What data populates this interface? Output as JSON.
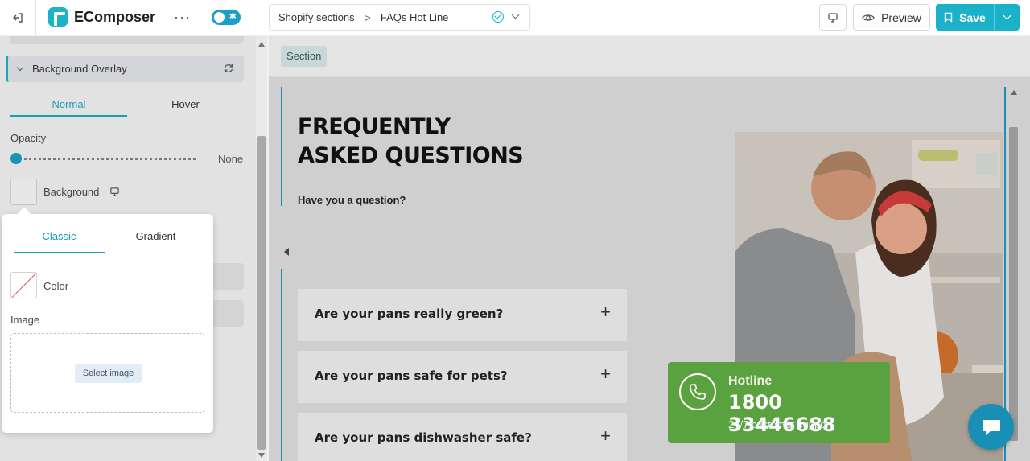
{
  "topbar": {
    "app_name": "EComposer",
    "more_label": "···",
    "breadcrumb": {
      "parent": "Shopify sections",
      "separator": ">",
      "current": "FAQs Hot Line"
    },
    "preview_label": "Preview",
    "save_label": "Save"
  },
  "left_panel": {
    "section_title": "Background Overlay",
    "tabs": [
      {
        "label": "Normal",
        "active": true
      },
      {
        "label": "Hover",
        "active": false
      }
    ],
    "opacity": {
      "label": "Opacity",
      "value_label": "None",
      "level": 0
    },
    "background_label": "Background"
  },
  "popover": {
    "tabs": [
      {
        "label": "Classic",
        "active": true
      },
      {
        "label": "Gradient",
        "active": false
      }
    ],
    "color_label": "Color",
    "image_label": "Image",
    "select_image_label": "Select image"
  },
  "canvas": {
    "section_tag": "Section",
    "title_line1": "FREQUENTLY",
    "title_line2": "ASKED QUESTIONS",
    "subtitle": "Have you a question?",
    "faq": [
      {
        "question": "Are your pans really green?"
      },
      {
        "question": "Are your pans safe for pets?"
      },
      {
        "question": "Are your pans dishwasher safe?"
      }
    ],
    "hotline": {
      "label": "Hotline",
      "number": "1800 33446688",
      "subtitle": "24/7 customer support"
    }
  },
  "colors": {
    "accent": "#1ab1c9",
    "hotline_green": "#5aa13f",
    "chat_blue": "#1890b5"
  },
  "icons": [
    "exit-icon",
    "eye-icon",
    "bookmark-icon",
    "monitor-icon",
    "reset-icon",
    "phone-icon",
    "chat-icon",
    "check-circle-icon",
    "chevron-down-icon",
    "plus-icon"
  ]
}
